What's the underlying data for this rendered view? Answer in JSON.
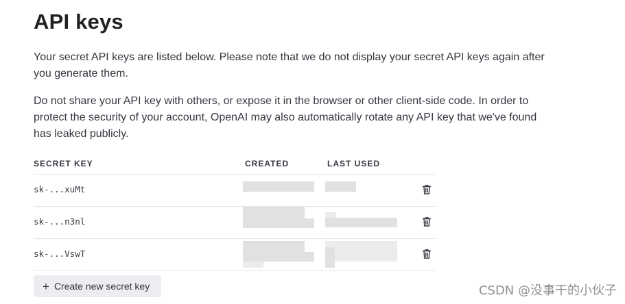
{
  "page": {
    "title": "API keys",
    "intro": "Your secret API keys are listed below. Please note that we do not display your secret API keys again after you generate them.",
    "warning": "Do not share your API key with others, or expose it in the browser or other client-side code. In order to protect the security of your account, OpenAI may also automatically rotate any API key that we've found has leaked publicly."
  },
  "table": {
    "headers": {
      "secret_key": "SECRET KEY",
      "created": "CREATED",
      "last_used": "LAST USED"
    },
    "rows": [
      {
        "key": "sk-...xuMt",
        "created": "",
        "last_used": "",
        "delete_icon": "trash-icon"
      },
      {
        "key": "sk-...n3nl",
        "created": "",
        "last_used": "",
        "delete_icon": "trash-icon"
      },
      {
        "key": "sk-...VswT",
        "created": "",
        "last_used": "",
        "delete_icon": "trash-icon"
      }
    ]
  },
  "actions": {
    "create_label": "Create new secret key",
    "create_icon": "plus-icon"
  },
  "watermark": {
    "text": "CSDN @没事干的小伙子"
  },
  "colors": {
    "text": "#353740",
    "heading": "#202123",
    "button_bg": "#ececf1",
    "divider": "#e6e6ea"
  }
}
